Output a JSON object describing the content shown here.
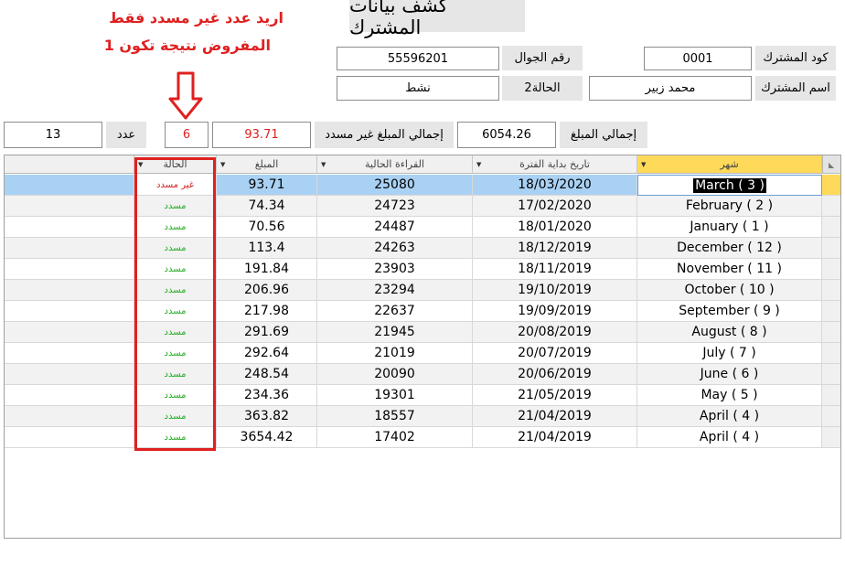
{
  "form": {
    "title": "كشف بيانات المشترك",
    "subscriber_code_label": "كود المشترك",
    "subscriber_code_value": "0001",
    "mobile_label": "رقم الجوال",
    "mobile_value": "55596201",
    "subscriber_name_label": "اسم المشترك",
    "subscriber_name_value": "محمد زبير",
    "status2_label": "الحالة2",
    "status2_value": "نشط",
    "total_amount_label": "إجمالي المبلغ",
    "total_amount_value": "6054.26",
    "total_unpaid_label": "إجمالي المبلغ غير مسدد",
    "total_unpaid_value": "93.71",
    "count_label": "عدد",
    "count_value": "13",
    "unpaid_count_value": "6"
  },
  "annotations": {
    "note_line1": "اريد عدد غير مسدد فقط",
    "note_line2": "المفروض نتيجة تكون 1",
    "color": "#e02020"
  },
  "grid": {
    "columns": {
      "month": "شهر",
      "period_start": "تاريخ بداية الفترة",
      "current_reading": "القراءة الحالية",
      "amount": "المبلغ",
      "status": "الحالة"
    },
    "rows": [
      {
        "month": "March ( 3 )",
        "date": "18/03/2020",
        "reading": "25080",
        "amount": "93.71",
        "status": "غير مسدد"
      },
      {
        "month": "February ( 2 )",
        "date": "17/02/2020",
        "reading": "24723",
        "amount": "74.34",
        "status": "مسدد"
      },
      {
        "month": "January ( 1 )",
        "date": "18/01/2020",
        "reading": "24487",
        "amount": "70.56",
        "status": "مسدد"
      },
      {
        "month": "December ( 12 )",
        "date": "18/12/2019",
        "reading": "24263",
        "amount": "113.4",
        "status": "مسدد"
      },
      {
        "month": "November ( 11 )",
        "date": "18/11/2019",
        "reading": "23903",
        "amount": "191.84",
        "status": "مسدد"
      },
      {
        "month": "October ( 10 )",
        "date": "19/10/2019",
        "reading": "23294",
        "amount": "206.96",
        "status": "مسدد"
      },
      {
        "month": "September ( 9 )",
        "date": "19/09/2019",
        "reading": "22637",
        "amount": "217.98",
        "status": "مسدد"
      },
      {
        "month": "August ( 8 )",
        "date": "20/08/2019",
        "reading": "21945",
        "amount": "291.69",
        "status": "مسدد"
      },
      {
        "month": "July ( 7 )",
        "date": "20/07/2019",
        "reading": "21019",
        "amount": "292.64",
        "status": "مسدد"
      },
      {
        "month": "June ( 6 )",
        "date": "20/06/2019",
        "reading": "20090",
        "amount": "248.54",
        "status": "مسدد"
      },
      {
        "month": "May ( 5 )",
        "date": "21/05/2019",
        "reading": "19301",
        "amount": "234.36",
        "status": "مسدد"
      },
      {
        "month": "April ( 4 )",
        "date": "21/04/2019",
        "reading": "18557",
        "amount": "363.82",
        "status": "مسدد"
      },
      {
        "month": "April ( 4 )",
        "date": "21/04/2019",
        "reading": "17402",
        "amount": "3654.42",
        "status": "مسدد"
      }
    ],
    "selected_row": 0
  },
  "icons": {
    "sort_arrow": "dropdown-arrow-icon",
    "select_all": "select-all-triangle-icon",
    "annotation_arrow_down": "arrow-down-icon",
    "annotation_arrow_right": "arrow-right-icon"
  }
}
